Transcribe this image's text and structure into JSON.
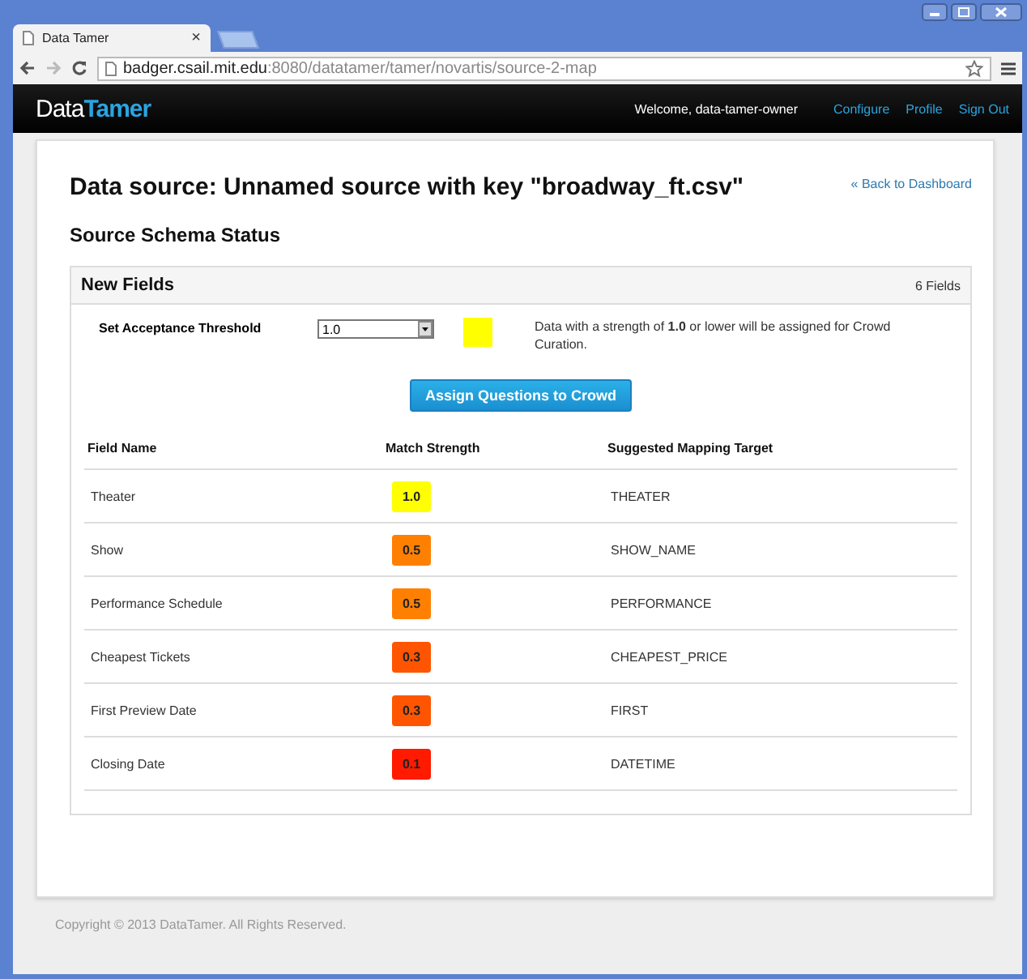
{
  "browser": {
    "tab_title": "Data Tamer",
    "tab_close": "×",
    "url_host": "badger.csail.mit.edu",
    "url_path": ":8080/datatamer/tamer/novartis/source-2-map"
  },
  "navbar": {
    "logo_part_1": "Data",
    "logo_part_2": "Tamer",
    "welcome": "Welcome, data-tamer-owner",
    "links": [
      "Configure",
      "Profile",
      "Sign Out"
    ]
  },
  "page": {
    "title": "Data source: Unnamed source with key \"broadway_ft.csv\"",
    "back_link": "« Back to Dashboard",
    "subtitle": "Source Schema Status"
  },
  "panel": {
    "title": "New Fields",
    "count": "6 Fields",
    "threshold_label": "Set Acceptance Threshold",
    "threshold_value": "1.0",
    "threshold_swatch": {
      "color": "#ffff00"
    },
    "threshold_note": "Data with a strength of **1.0** or lower will be assigned for Crowd Curation.",
    "assign_button": "Assign Questions to Crowd"
  },
  "table": {
    "columns": [
      "Field Name",
      "Match Strength",
      "Suggested Mapping Target"
    ],
    "rows": [
      {
        "field": "Theater",
        "strength": "1.0",
        "color": "#ffff00",
        "target": "THEATER"
      },
      {
        "field": "Show",
        "strength": "0.5",
        "color": "#ff8000",
        "target": "SHOW_NAME"
      },
      {
        "field": "Performance Schedule",
        "strength": "0.5",
        "color": "#ff8000",
        "target": "PERFORMANCE"
      },
      {
        "field": "Cheapest Tickets",
        "strength": "0.3",
        "color": "#ff5500",
        "target": "CHEAPEST_PRICE"
      },
      {
        "field": "First Preview Date",
        "strength": "0.3",
        "color": "#ff5500",
        "target": "FIRST"
      },
      {
        "field": "Closing Date",
        "strength": "0.1",
        "color": "#ff1a00",
        "target": "DATETIME"
      }
    ]
  },
  "footer": "Copyright © 2013 DataTamer. All Rights Reserved."
}
